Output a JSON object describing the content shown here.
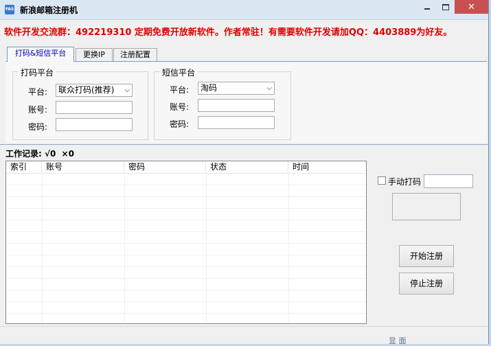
{
  "window": {
    "title": "新浪邮箱注册机",
    "icon_text": "FAS"
  },
  "banner": "软件开发交流群：492219310  定期免费开放新软件。作者常驻！有需要软件开发请加QQ：4403889为好友。",
  "tabs": [
    {
      "label": "打码&短信平台",
      "active": true
    },
    {
      "label": "更换IP",
      "active": false
    },
    {
      "label": "注册配置",
      "active": false
    }
  ],
  "captcha_group": {
    "title": "打码平台",
    "platform_label": "平台:",
    "platform_value": "联众打码(推荐)",
    "account_label": "账号:",
    "password_label": "密码:"
  },
  "sms_group": {
    "title": "短信平台",
    "platform_label": "平台:",
    "platform_value": "淘码",
    "account_label": "账号:",
    "password_label": "密码:"
  },
  "work_log": {
    "label": "工作记录:",
    "success_count": "√0",
    "fail_count": "×0"
  },
  "table": {
    "columns": [
      "索引",
      "账号",
      "密码",
      "状态",
      "时间"
    ],
    "rows": []
  },
  "controls": {
    "manual_captcha_label": "手动打码",
    "manual_captcha_checked": false,
    "start_button": "开始注册",
    "stop_button": "停止注册"
  },
  "background_glyphs": [
    "显",
    "面"
  ],
  "colors": {
    "banner": "#e00000",
    "active_tab_text": "#0000c0",
    "close_button": "#c75050"
  }
}
